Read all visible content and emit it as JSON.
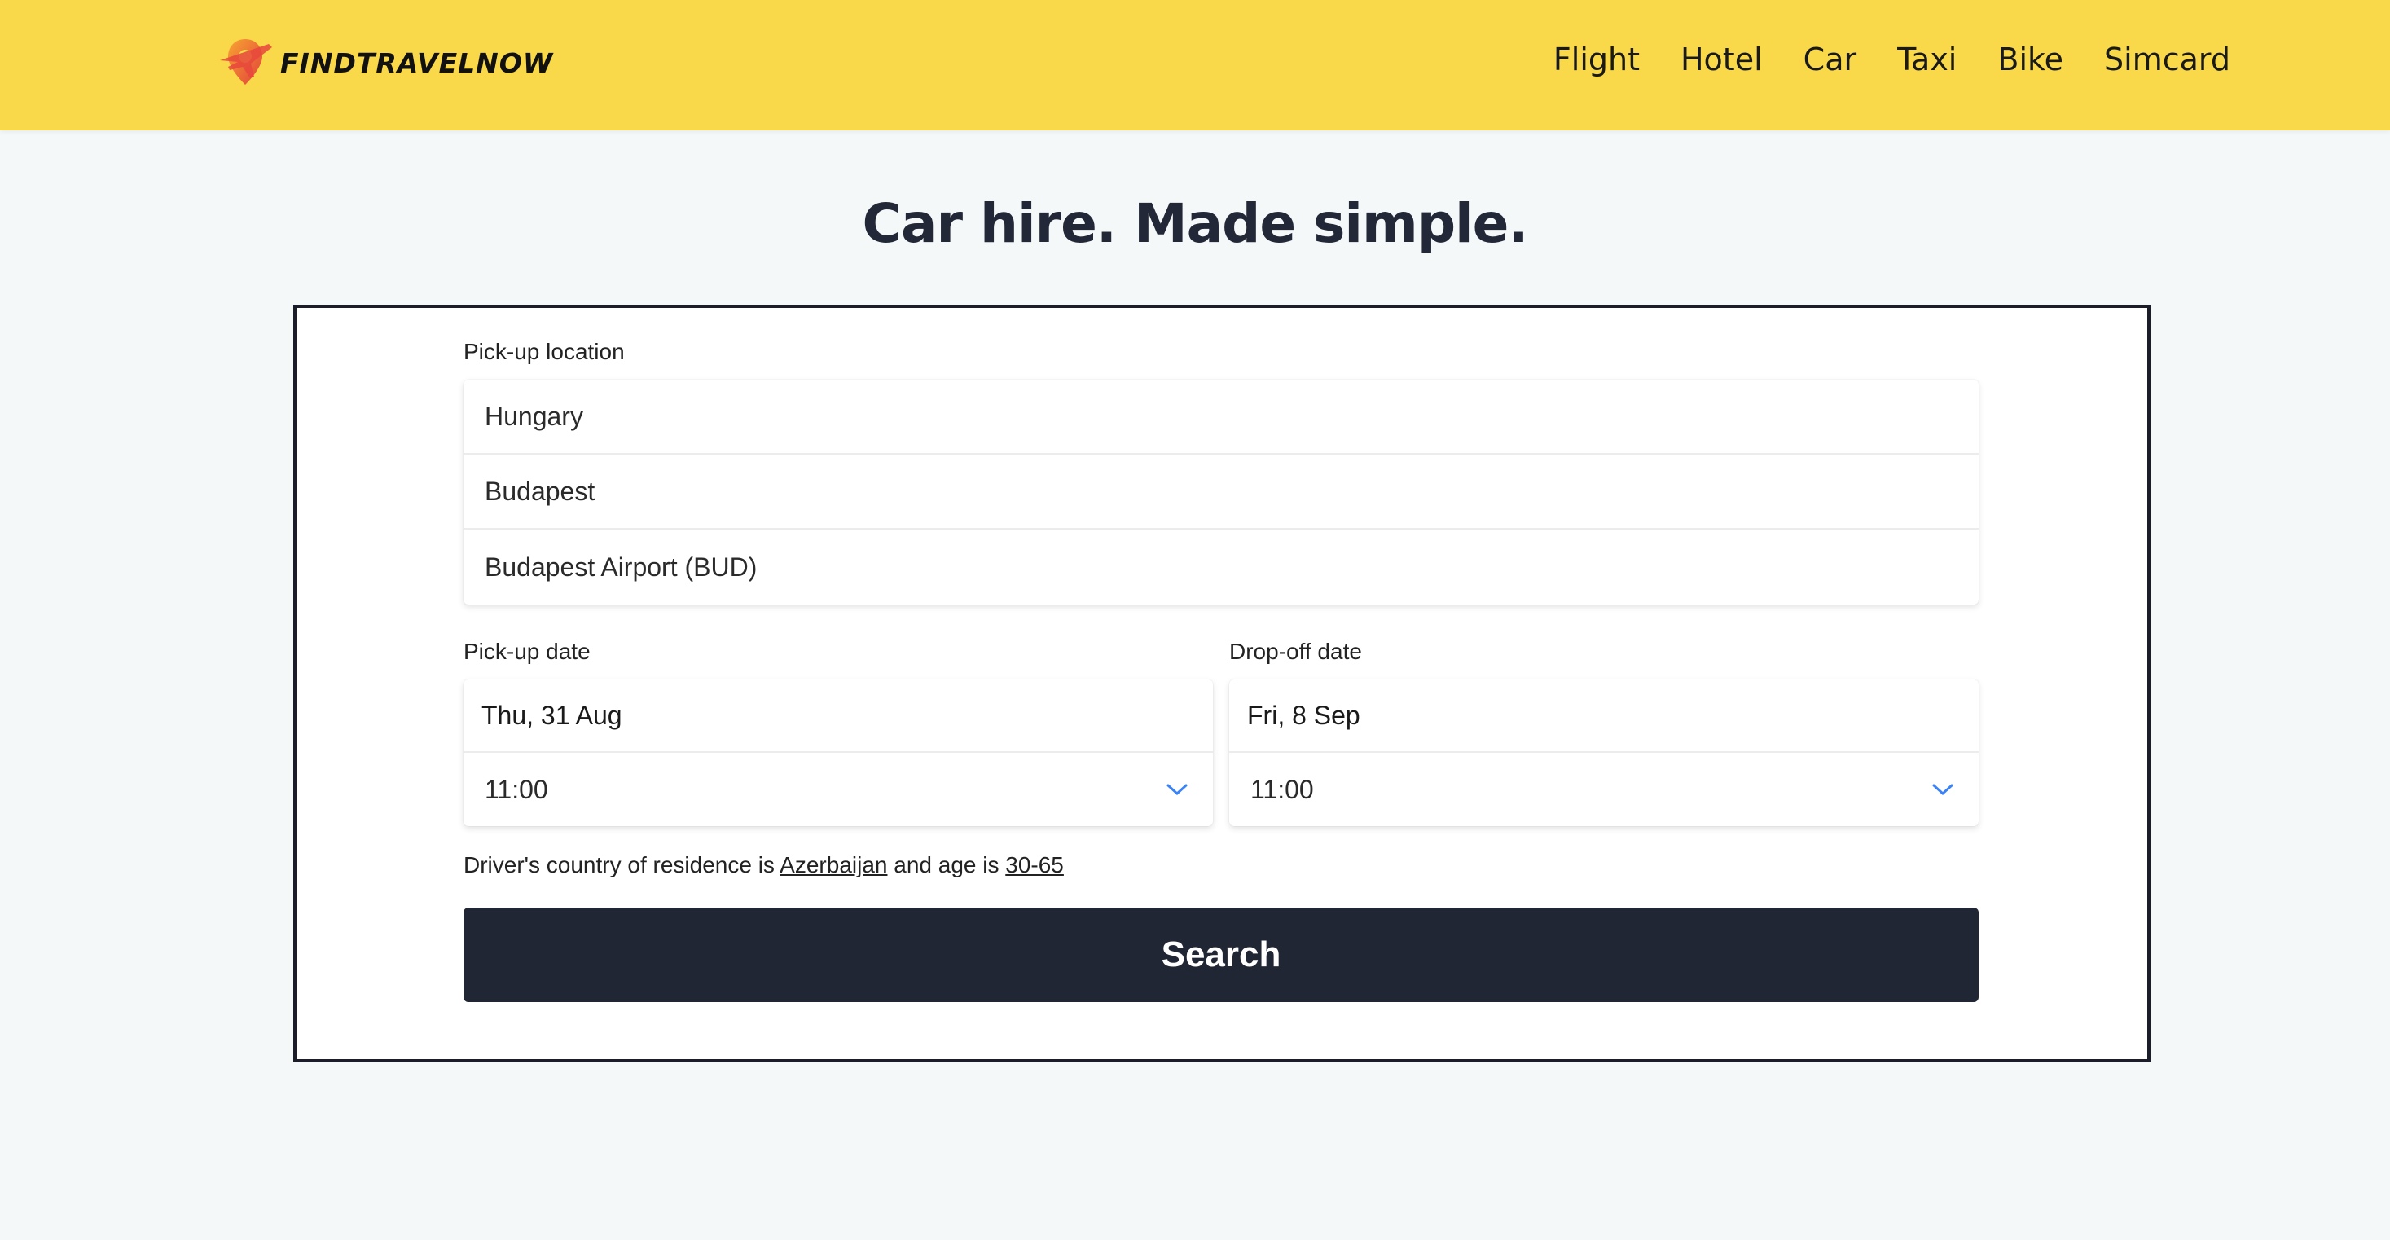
{
  "header": {
    "logo_text": "FINDTRAVELNOW",
    "nav": [
      "Flight",
      "Hotel",
      "Car",
      "Taxi",
      "Bike",
      "Simcard"
    ]
  },
  "headline": "Car hire. Made simple.",
  "pickup_location": {
    "label": "Pick-up location",
    "country": "Hungary",
    "city": "Budapest",
    "place": "Budapest Airport (BUD)"
  },
  "pickup_date": {
    "label": "Pick-up date",
    "date": "Thu, 31 Aug",
    "time": "11:00"
  },
  "dropoff_date": {
    "label": "Drop-off date",
    "date": "Fri, 8 Sep",
    "time": "11:00"
  },
  "driver": {
    "prefix": "Driver's country of residence is",
    "country": "Azerbaijan",
    "middle": "and age is",
    "age": "30-65"
  },
  "search_label": "Search",
  "colors": {
    "header_bg": "#f9d849",
    "button_bg": "#212635",
    "chevron": "#3b82f6"
  }
}
